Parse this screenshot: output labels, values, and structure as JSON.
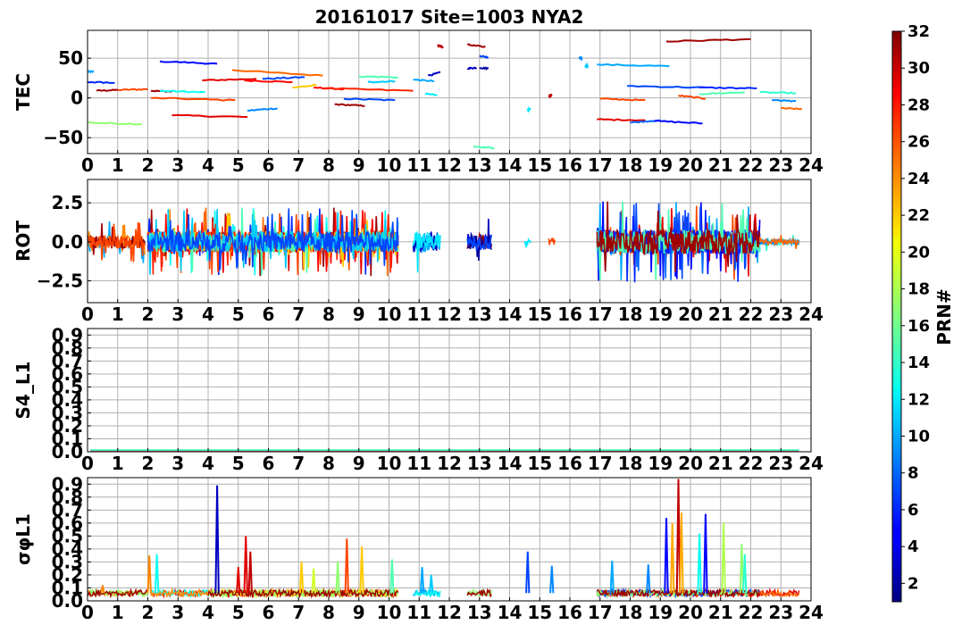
{
  "title": "20161017 Site=1003 NYA2",
  "colorbar": {
    "label": "PRN#",
    "min": 1,
    "max": 32,
    "ticks": [
      "2",
      "4",
      "6",
      "8",
      "10",
      "12",
      "14",
      "16",
      "18",
      "20",
      "22",
      "24",
      "26",
      "28",
      "30",
      "32"
    ],
    "colormap": "jet"
  },
  "chart_data": [
    {
      "type": "line",
      "ylabel": "TEC",
      "ylim": [
        -70,
        85
      ],
      "xlim": [
        0,
        24
      ],
      "xticks": [
        "0",
        "1",
        "2",
        "3",
        "4",
        "5",
        "6",
        "7",
        "8",
        "9",
        "10",
        "11",
        "12",
        "13",
        "14",
        "15",
        "16",
        "17",
        "18",
        "19",
        "20",
        "21",
        "22",
        "23",
        "24"
      ],
      "yticks": [
        "−50",
        "0",
        "50"
      ],
      "ytick_values": [
        -50,
        0,
        50
      ],
      "grid": true,
      "series": [
        {
          "prn": 10,
          "x": [
            0.0,
            0.2
          ],
          "y": [
            33,
            33
          ]
        },
        {
          "prn": 6,
          "x": [
            0.0,
            0.9
          ],
          "y": [
            20,
            19
          ]
        },
        {
          "prn": 31,
          "x": [
            0.3,
            1.0
          ],
          "y": [
            9,
            10
          ]
        },
        {
          "prn": 26,
          "x": [
            1.0,
            2.0
          ],
          "y": [
            10,
            11
          ]
        },
        {
          "prn": 17,
          "x": [
            0.0,
            1.8
          ],
          "y": [
            -31,
            -33
          ]
        },
        {
          "prn": 31,
          "x": [
            2.1,
            2.8
          ],
          "y": [
            9,
            8
          ]
        },
        {
          "prn": 13,
          "x": [
            2.4,
            3.9
          ],
          "y": [
            9,
            7
          ]
        },
        {
          "prn": 26,
          "x": [
            2.1,
            4.9
          ],
          "y": [
            0,
            -3
          ]
        },
        {
          "prn": 5,
          "x": [
            2.4,
            4.3
          ],
          "y": [
            46,
            43
          ]
        },
        {
          "prn": 29,
          "x": [
            2.8,
            5.3
          ],
          "y": [
            -22,
            -24
          ]
        },
        {
          "prn": 29,
          "x": [
            3.8,
            5.6
          ],
          "y": [
            22,
            24
          ]
        },
        {
          "prn": 25,
          "x": [
            4.8,
            7.8
          ],
          "y": [
            35,
            28
          ]
        },
        {
          "prn": 28,
          "x": [
            5.2,
            6.8
          ],
          "y": [
            22,
            20
          ]
        },
        {
          "prn": 7,
          "x": [
            5.8,
            7.2
          ],
          "y": [
            24,
            26
          ]
        },
        {
          "prn": 9,
          "x": [
            5.3,
            6.3
          ],
          "y": [
            -16,
            -13
          ]
        },
        {
          "prn": 22,
          "x": [
            6.8,
            7.6
          ],
          "y": [
            13,
            16
          ]
        },
        {
          "prn": 28,
          "x": [
            7.5,
            8.5
          ],
          "y": [
            13,
            11
          ]
        },
        {
          "prn": 27,
          "x": [
            7.8,
            10.8
          ],
          "y": [
            12,
            9
          ]
        },
        {
          "prn": 31,
          "x": [
            8.2,
            9.2
          ],
          "y": [
            -8,
            -10
          ]
        },
        {
          "prn": 7,
          "x": [
            8.5,
            10.2
          ],
          "y": [
            -1,
            -3
          ]
        },
        {
          "prn": 11,
          "x": [
            9.3,
            10.2
          ],
          "y": [
            20,
            21
          ]
        },
        {
          "prn": 15,
          "x": [
            9.0,
            10.3
          ],
          "y": [
            27,
            26
          ]
        },
        {
          "prn": 10,
          "x": [
            10.8,
            11.5
          ],
          "y": [
            23,
            21
          ]
        },
        {
          "prn": 12,
          "x": [
            11.2,
            11.6
          ],
          "y": [
            5,
            4
          ]
        },
        {
          "prn": 3,
          "x": [
            11.3,
            11.7
          ],
          "y": [
            28,
            32
          ]
        },
        {
          "prn": 30,
          "x": [
            11.6,
            11.8
          ],
          "y": [
            66,
            64
          ]
        },
        {
          "prn": 31,
          "x": [
            12.6,
            13.2
          ],
          "y": [
            67,
            64
          ]
        },
        {
          "prn": 3,
          "x": [
            12.6,
            12.9
          ],
          "y": [
            37,
            38
          ]
        },
        {
          "prn": 2,
          "x": [
            13.0,
            13.3
          ],
          "y": [
            38,
            37
          ]
        },
        {
          "prn": 7,
          "x": [
            13.0,
            13.3
          ],
          "y": [
            53,
            51
          ]
        },
        {
          "prn": 15,
          "x": [
            12.8,
            13.5
          ],
          "y": [
            -61,
            -63
          ]
        },
        {
          "prn": 12,
          "x": [
            14.6,
            14.7
          ],
          "y": [
            -15,
            -14
          ]
        },
        {
          "prn": 30,
          "x": [
            15.3,
            15.4
          ],
          "y": [
            3,
            3
          ]
        },
        {
          "prn": 9,
          "x": [
            16.3,
            16.4
          ],
          "y": [
            50,
            50
          ]
        },
        {
          "prn": 11,
          "x": [
            16.5,
            16.6
          ],
          "y": [
            40,
            40
          ]
        },
        {
          "prn": 10,
          "x": [
            16.9,
            19.3
          ],
          "y": [
            42,
            40
          ]
        },
        {
          "prn": 26,
          "x": [
            17.0,
            18.5
          ],
          "y": [
            -1,
            -3
          ]
        },
        {
          "prn": 29,
          "x": [
            16.9,
            18.5
          ],
          "y": [
            -27,
            -28
          ]
        },
        {
          "prn": 8,
          "x": [
            18.0,
            19.0
          ],
          "y": [
            -31,
            -28
          ]
        },
        {
          "prn": 5,
          "x": [
            18.8,
            20.4
          ],
          "y": [
            -29,
            -32
          ]
        },
        {
          "prn": 7,
          "x": [
            17.9,
            20.5
          ],
          "y": [
            15,
            13
          ]
        },
        {
          "prn": 6,
          "x": [
            20.3,
            22.2
          ],
          "y": [
            13,
            12
          ]
        },
        {
          "prn": 26,
          "x": [
            19.6,
            20.5
          ],
          "y": [
            3,
            -1
          ]
        },
        {
          "prn": 15,
          "x": [
            20.3,
            21.8
          ],
          "y": [
            5,
            7
          ]
        },
        {
          "prn": 31,
          "x": [
            19.2,
            22.0
          ],
          "y": [
            71,
            74
          ]
        },
        {
          "prn": 14,
          "x": [
            22.3,
            23.5
          ],
          "y": [
            7,
            6
          ]
        },
        {
          "prn": 9,
          "x": [
            22.7,
            23.5
          ],
          "y": [
            -3,
            -4
          ]
        },
        {
          "prn": 25,
          "x": [
            23.0,
            23.7
          ],
          "y": [
            -13,
            -14
          ]
        }
      ]
    },
    {
      "type": "line",
      "ylabel": "ROT",
      "ylim": [
        -3.9,
        4.0
      ],
      "xlim": [
        0,
        24
      ],
      "xticks": [
        "0",
        "1",
        "2",
        "3",
        "4",
        "5",
        "6",
        "7",
        "8",
        "9",
        "10",
        "11",
        "12",
        "13",
        "14",
        "15",
        "16",
        "17",
        "18",
        "19",
        "20",
        "21",
        "22",
        "23",
        "24"
      ],
      "yticks": [
        "−2.5",
        "0.0",
        "2.5"
      ],
      "ytick_values": [
        -2.5,
        0,
        2.5
      ],
      "grid": true,
      "segments": [
        {
          "start": 0.0,
          "end": 1.9,
          "amp": 1.4,
          "prns": [
            10,
            24,
            31,
            26
          ]
        },
        {
          "start": 2.0,
          "end": 10.3,
          "amp": 2.2,
          "prns": [
            6,
            13,
            26,
            29,
            31,
            25,
            28,
            22,
            27,
            15,
            11,
            7
          ]
        },
        {
          "start": 10.8,
          "end": 11.7,
          "amp": 2.2,
          "prns": [
            10,
            3,
            12
          ]
        },
        {
          "start": 12.6,
          "end": 13.4,
          "amp": 1.7,
          "prns": [
            3,
            31,
            2,
            7
          ]
        },
        {
          "start": 14.5,
          "end": 14.7,
          "amp": 0.5,
          "prns": [
            12
          ]
        },
        {
          "start": 15.3,
          "end": 15.5,
          "amp": 1.2,
          "prns": [
            26
          ]
        },
        {
          "start": 16.9,
          "end": 22.3,
          "amp": 2.6,
          "prns": [
            10,
            26,
            29,
            8,
            5,
            7,
            6,
            15,
            31
          ]
        },
        {
          "start": 22.3,
          "end": 23.6,
          "amp": 0.6,
          "prns": [
            14,
            9,
            25
          ]
        }
      ]
    },
    {
      "type": "line",
      "ylabel": "S4_L1",
      "ylim": [
        0.0,
        0.95
      ],
      "xlim": [
        0,
        24
      ],
      "xticks": [
        "0",
        "1",
        "2",
        "3",
        "4",
        "5",
        "6",
        "7",
        "8",
        "9",
        "10",
        "11",
        "12",
        "13",
        "14",
        "15",
        "16",
        "17",
        "18",
        "19",
        "20",
        "21",
        "22",
        "23",
        "24"
      ],
      "yticks": [
        "0.0",
        "0.1",
        "0.2",
        "0.3",
        "0.4",
        "0.5",
        "0.6",
        "0.7",
        "0.8",
        "0.9"
      ],
      "ytick_values": [
        0.0,
        0.1,
        0.2,
        0.3,
        0.4,
        0.5,
        0.6,
        0.7,
        0.8,
        0.9
      ],
      "grid": true,
      "baseline_value": 0.01
    },
    {
      "type": "line",
      "ylabel": "σφL1",
      "ylim": [
        0.0,
        0.95
      ],
      "xlim": [
        0,
        24
      ],
      "xticks": [
        "0",
        "1",
        "2",
        "3",
        "4",
        "5",
        "6",
        "7",
        "8",
        "9",
        "10",
        "11",
        "12",
        "13",
        "14",
        "15",
        "16",
        "17",
        "18",
        "19",
        "20",
        "21",
        "22",
        "23",
        "24"
      ],
      "yticks": [
        "0.0",
        "0.1",
        "0.2",
        "0.3",
        "0.4",
        "0.5",
        "0.6",
        "0.7",
        "0.8",
        "0.9"
      ],
      "ytick_values": [
        0.0,
        0.1,
        0.2,
        0.3,
        0.4,
        0.5,
        0.6,
        0.7,
        0.8,
        0.9
      ],
      "grid": true,
      "baseline": 0.06,
      "spikes": [
        {
          "prn": 24,
          "x": 0.5,
          "y": 0.12
        },
        {
          "prn": 24,
          "x": 2.05,
          "y": 0.35
        },
        {
          "prn": 13,
          "x": 2.3,
          "y": 0.36
        },
        {
          "prn": 3,
          "x": 4.3,
          "y": 0.89
        },
        {
          "prn": 29,
          "x": 5.0,
          "y": 0.26
        },
        {
          "prn": 29,
          "x": 5.25,
          "y": 0.5
        },
        {
          "prn": 30,
          "x": 5.4,
          "y": 0.38
        },
        {
          "prn": 22,
          "x": 7.1,
          "y": 0.3
        },
        {
          "prn": 19,
          "x": 7.5,
          "y": 0.25
        },
        {
          "prn": 26,
          "x": 8.6,
          "y": 0.48
        },
        {
          "prn": 17,
          "x": 8.3,
          "y": 0.3
        },
        {
          "prn": 22,
          "x": 9.1,
          "y": 0.42
        },
        {
          "prn": 15,
          "x": 10.1,
          "y": 0.32
        },
        {
          "prn": 10,
          "x": 11.1,
          "y": 0.26
        },
        {
          "prn": 11,
          "x": 11.4,
          "y": 0.2
        },
        {
          "prn": 7,
          "x": 14.6,
          "y": 0.38
        },
        {
          "prn": 9,
          "x": 15.4,
          "y": 0.27
        },
        {
          "prn": 10,
          "x": 17.4,
          "y": 0.31
        },
        {
          "prn": 9,
          "x": 18.6,
          "y": 0.28
        },
        {
          "prn": 5,
          "x": 19.2,
          "y": 0.64
        },
        {
          "prn": 23,
          "x": 19.4,
          "y": 0.6
        },
        {
          "prn": 30,
          "x": 19.6,
          "y": 0.94
        },
        {
          "prn": 23,
          "x": 19.7,
          "y": 0.68
        },
        {
          "prn": 13,
          "x": 20.3,
          "y": 0.52
        },
        {
          "prn": 5,
          "x": 20.5,
          "y": 0.67
        },
        {
          "prn": 18,
          "x": 21.1,
          "y": 0.6
        },
        {
          "prn": 17,
          "x": 21.7,
          "y": 0.44
        },
        {
          "prn": 14,
          "x": 21.8,
          "y": 0.36
        }
      ]
    }
  ]
}
